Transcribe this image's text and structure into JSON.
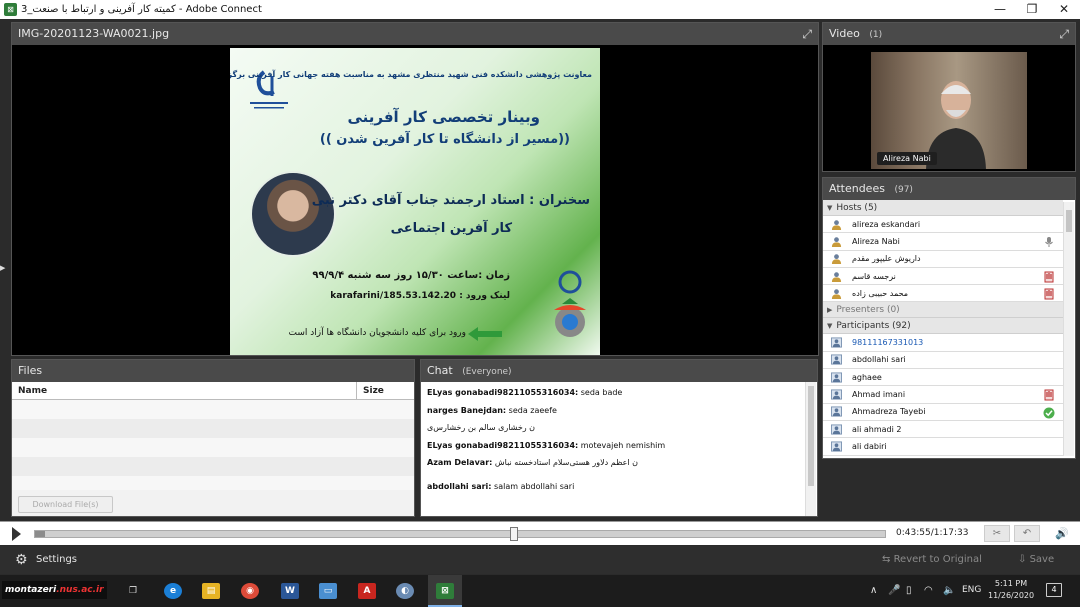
{
  "window": {
    "title": "کمیته کار آفرینی و ارتباط با صنعت_3 - Adobe Connect",
    "app_icon": "adobe-connect-icon",
    "minimize": "—",
    "maximize": "❐",
    "close": "✕"
  },
  "share_pod": {
    "title": "IMG-20201123-WA0021.jpg",
    "expand_icon": "expand-icon",
    "poster": {
      "line1": "معاونت پژوهشی دانشکده فنی شهید منتظری مشهد به مناسبت هفته جهانی کار آفرینی برگزار می کند",
      "line2": "وبینار تخصصی کار آفرینی",
      "line3": "((مسیر از دانشگاه تا کار آفرین شدن ))",
      "line4": "سخنران : استاد ارجمند جناب آقای دکتر نبی",
      "line5": "کار آفرین اجتماعی",
      "line6": "زمان :ساعت ۱۵/۳۰ روز سه شنبه ۹۹/۹/۴",
      "line7_label": "لینک ورود :",
      "line7_link": "185.53.142.20/karafarini",
      "line8": "ورود برای کلیه دانشجویان دانشگاه ها آزاد است"
    }
  },
  "video_pod": {
    "title": "Video",
    "count": "(1)",
    "name_badge": "Alireza Nabi"
  },
  "attendees_pod": {
    "title": "Attendees",
    "count": "(97)",
    "hosts_label": "Hosts (5)",
    "presenters_label": "Presenters (0)",
    "participants_label": "Participants (92)",
    "hosts": [
      {
        "name": "alireza eskandari",
        "status": ""
      },
      {
        "name": "Alireza Nabi",
        "status": "mic"
      },
      {
        "name": "داریوش علیپور مقدم",
        "status": ""
      },
      {
        "name": "نرجسه قاسم",
        "status": "raise"
      },
      {
        "name": "محمد حبیبی زاده",
        "status": "raise"
      }
    ],
    "participants": [
      {
        "name": "98111167331013",
        "status": "",
        "selected": true
      },
      {
        "name": "abdollahi  sari",
        "status": ""
      },
      {
        "name": "aghaee",
        "status": ""
      },
      {
        "name": "Ahmad imani",
        "status": "raise"
      },
      {
        "name": "Ahmadreza Tayebi",
        "status": "agree"
      },
      {
        "name": "ali ahmadi 2",
        "status": ""
      },
      {
        "name": "ali dabiri",
        "status": ""
      }
    ]
  },
  "files_pod": {
    "title": "Files",
    "col_name": "Name",
    "col_size": "Size",
    "download_button": "Download File(s)"
  },
  "chat_pod": {
    "title": "Chat",
    "scope": "(Everyone)",
    "messages": [
      {
        "who": "ELyas gonabadi98211055316034:",
        "text": " seda bade"
      },
      {
        "who": "narges Banejdan:",
        "text": " seda zaeefe"
      },
      {
        "who": "",
        "text": "ن رخشاری‌ سالم بن رخشارس‌ی"
      },
      {
        "who": "ELyas gonabadi98211055316034:",
        "text": " motevajeh nemishim"
      },
      {
        "who": "Azam Delavar:",
        "text": " ن اعظم دلاور هستی‌سلام استادخسته نباش"
      },
      {
        "who": "abdollahi   sari:",
        "text": " salam  abdollahi  sari"
      }
    ]
  },
  "playback": {
    "time": "0:43:55/1:17:33",
    "progress": 0.5634
  },
  "settings_bar": {
    "settings_label": "Settings",
    "revert_label": "Revert to Original",
    "save_label": "Save"
  },
  "taskbar": {
    "watermark_main": "montazeri",
    "watermark_accent": ".nus.ac.ir",
    "language": "ENG",
    "time": "5:11 PM",
    "date": "11/26/2020",
    "notifications": "4"
  }
}
